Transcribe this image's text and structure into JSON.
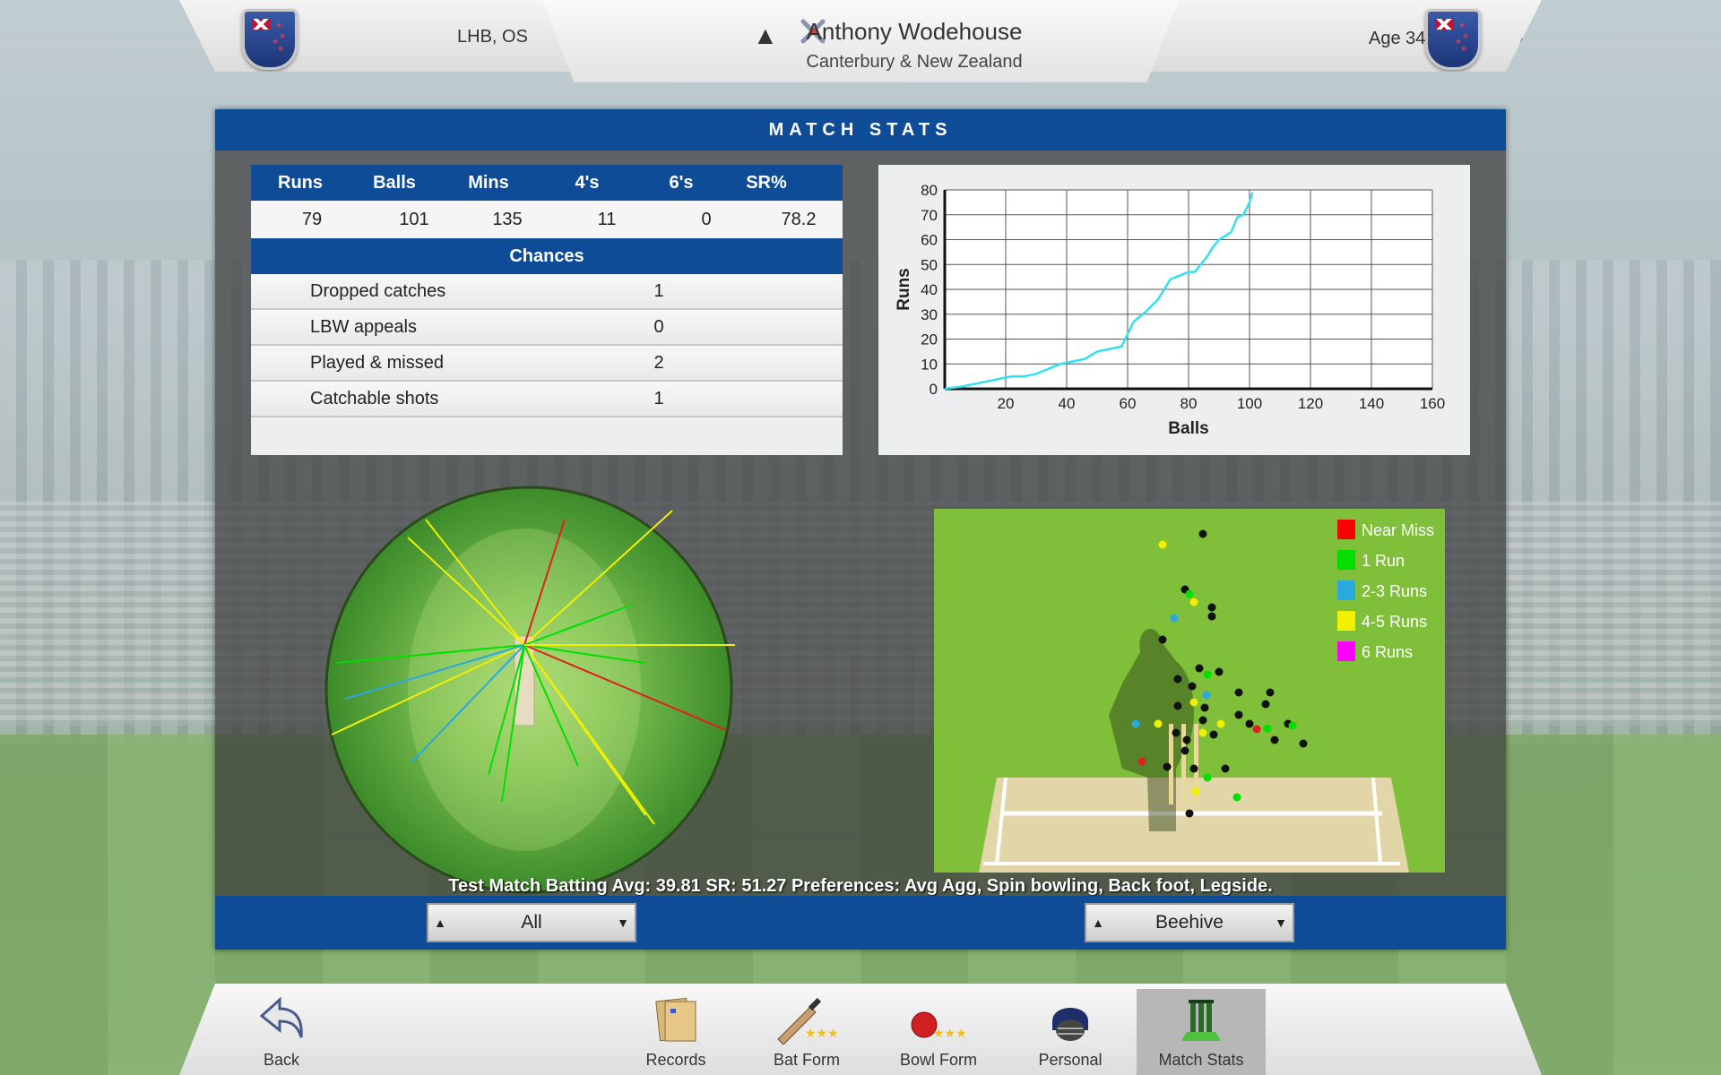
{
  "header": {
    "hand_info": "LHB, OS",
    "player_name": "Anthony Wodehouse",
    "team": "Canterbury & New Zealand",
    "age": "Age 34"
  },
  "panel_title": "MATCH STATS",
  "stats": {
    "columns": [
      "Runs",
      "Balls",
      "Mins",
      "4's",
      "6's",
      "SR%"
    ],
    "values": [
      "79",
      "101",
      "135",
      "11",
      "0",
      "78.2"
    ]
  },
  "chances": {
    "title": "Chances",
    "rows": [
      {
        "label": "Dropped catches",
        "value": "1"
      },
      {
        "label": "LBW appeals",
        "value": "0"
      },
      {
        "label": "Played & missed",
        "value": "2"
      },
      {
        "label": "Catchable shots",
        "value": "1"
      }
    ]
  },
  "chart_data": {
    "type": "line",
    "xlabel": "Balls",
    "ylabel": "Runs",
    "xlim": [
      0,
      160
    ],
    "ylim": [
      0,
      80
    ],
    "xticks": [
      20,
      40,
      60,
      80,
      100,
      120,
      140,
      160
    ],
    "yticks": [
      0,
      10,
      20,
      30,
      40,
      50,
      60,
      70,
      80
    ],
    "grid": true,
    "series": [
      {
        "color": "#33e0f0",
        "x": [
          0,
          6,
          10,
          14,
          18,
          22,
          26,
          30,
          34,
          38,
          42,
          46,
          50,
          54,
          58,
          62,
          64,
          66,
          70,
          72,
          74,
          78,
          80,
          82,
          84,
          86,
          88,
          90,
          94,
          96,
          98,
          100,
          101
        ],
        "y": [
          0,
          1,
          2,
          3,
          4,
          5,
          5,
          6,
          8,
          10,
          11,
          12,
          15,
          16,
          17,
          27,
          29,
          31,
          36,
          40,
          44,
          46,
          47,
          47,
          50,
          53,
          57,
          60,
          63,
          69,
          70,
          75,
          79
        ]
      }
    ]
  },
  "summary": "Test Match Batting Avg: 39.81    SR: 51.27    Preferences: Avg Agg, Spin bowling, Back foot, Legside.",
  "dropdowns": {
    "left": "All",
    "right": "Beehive"
  },
  "legend": [
    "Near Miss",
    "1 Run",
    "2-3 Runs",
    "4-5 Runs",
    "6 Runs"
  ],
  "legend_colors": [
    "#ff0000",
    "#00e000",
    "#2aa8e0",
    "#f0f000",
    "#ff00ff"
  ],
  "nav": {
    "back": "Back",
    "records": "Records",
    "bat_form": "Bat Form",
    "bowl_form": "Bowl Form",
    "personal": "Personal",
    "match_stats": "Match Stats"
  },
  "icons": {
    "flag_left": "nz-shield-icon",
    "flag_right": "nz-shield-icon",
    "edit": "pencil-icon",
    "tools": "crossed-bats-icon"
  }
}
